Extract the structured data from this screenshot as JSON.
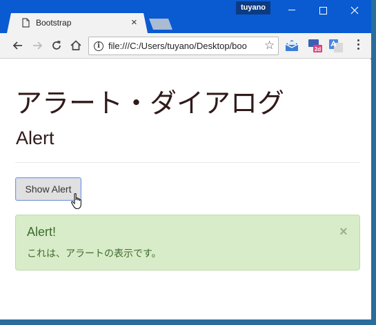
{
  "titlebar": {
    "tab_title": "Bootstrap",
    "tab_close": "×",
    "user": "tuyano"
  },
  "toolbar": {
    "url": "file:///C:/Users/tuyano/Desktop/boo",
    "info_glyph": "i",
    "star_glyph": "☆",
    "ext_2d_label": "2d"
  },
  "page": {
    "heading": "アラート・ダイアログ",
    "subheading": "Alert",
    "button_label": "Show Alert",
    "alert": {
      "title": "Alert!",
      "text": "これは、アラートの表示です。",
      "close": "×"
    }
  },
  "colors": {
    "titlebar": "#0a5bd1",
    "alert_bg": "#d9ecc9",
    "alert_text": "#3c6b2e",
    "heading_text": "#301a1a"
  }
}
